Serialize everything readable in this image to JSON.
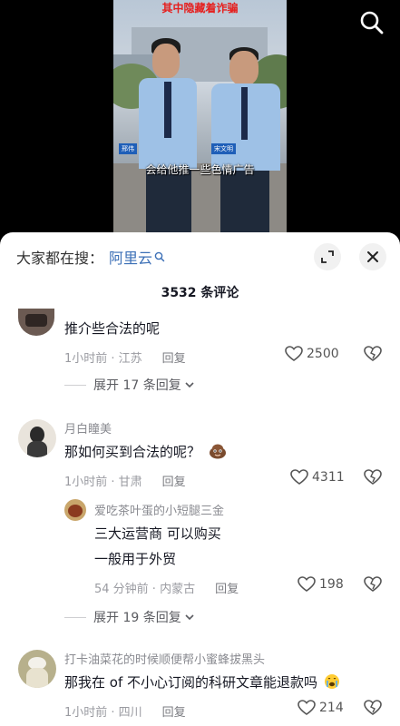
{
  "video": {
    "banner": "其中隐藏着诈骗",
    "subtitle": "会给他推一些色情广告",
    "nameplates": [
      "邢伟",
      "宋文明"
    ]
  },
  "sheet": {
    "search_prefix": "大家都在搜：",
    "search_term": "阿里云",
    "comment_count": "3532 条评论"
  },
  "comments": [
    {
      "text": "推介些合法的呢",
      "time": "1小时前 · 江苏",
      "reply_label": "回复",
      "likes": "2500",
      "expand": "展开 17 条回复"
    },
    {
      "author": "月白瞳美",
      "text": "那如何买到合法的呢？",
      "time": "1小时前 · 甘肃",
      "reply_label": "回复",
      "likes": "4311",
      "reply": {
        "author": "爱吃茶叶蛋的小短腿三金",
        "text_line1": "三大运营商 可以购买",
        "text_line2": "一般用于外贸",
        "time": "54 分钟前 · 内蒙古",
        "reply_label": "回复",
        "likes": "198"
      },
      "expand": "展开 19 条回复"
    },
    {
      "author": "打卡油菜花的时候顺便帮小蜜蜂拔黑头",
      "text": "那我在 of 不小心订阅的科研文章能退款吗",
      "time": "1小时前 · 四川",
      "reply_label": "回复",
      "likes": "214"
    }
  ],
  "colors": {
    "link": "#3b6fb6",
    "banner_red": "#e5201f",
    "gray_text": "#9a9ba1"
  },
  "icons": [
    "search-icon",
    "expand-icon",
    "close-icon",
    "heart-icon",
    "dislike-heart-icon",
    "chevron-down-icon",
    "emoji-icon"
  ]
}
